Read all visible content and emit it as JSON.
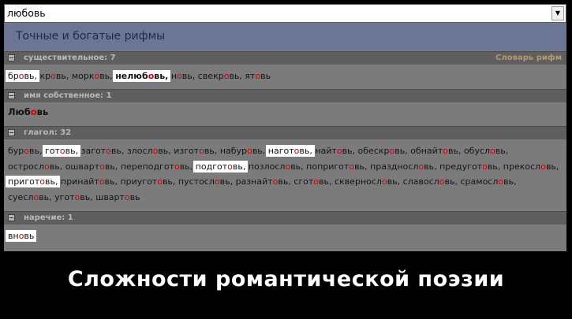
{
  "search": {
    "value": "любовь",
    "dropdown_glyph": "▼"
  },
  "header": {
    "title": "Точные и богатые рифмы"
  },
  "sections": [
    {
      "label": "существительное: 7",
      "link": "Словарь рифм",
      "words": [
        {
          "pre": "бр",
          "hl": "о",
          "post": "вь,",
          "box": true,
          "bold": false
        },
        {
          "pre": "кр",
          "hl": "о",
          "post": "вь,",
          "box": false,
          "bold": false
        },
        {
          "pre": "морк",
          "hl": "о",
          "post": "вь,",
          "box": false,
          "bold": false
        },
        {
          "pre": "нелюб",
          "hl": "о",
          "post": "вь,",
          "box": true,
          "bold": true
        },
        {
          "pre": "н",
          "hl": "о",
          "post": "вь,",
          "box": false,
          "bold": false
        },
        {
          "pre": "свекр",
          "hl": "о",
          "post": "вь,",
          "box": false,
          "bold": false
        },
        {
          "pre": "ят",
          "hl": "о",
          "post": "вь",
          "box": false,
          "bold": false
        }
      ]
    },
    {
      "label": "имя собственное: 1",
      "words": [
        {
          "pre": "Люб",
          "hl": "о",
          "post": "вь",
          "box": false,
          "bold": true
        }
      ]
    },
    {
      "label": "глагол: 32",
      "words": [
        {
          "pre": "бур",
          "hl": "о",
          "post": "вь,",
          "box": false,
          "bold": false
        },
        {
          "pre": "гот",
          "hl": "о",
          "post": "вь,",
          "box": true,
          "bold": false
        },
        {
          "pre": "загот",
          "hl": "о",
          "post": "вь,",
          "box": false,
          "bold": false
        },
        {
          "pre": "злосл",
          "hl": "о",
          "post": "вь,",
          "box": false,
          "bold": false
        },
        {
          "pre": "изгот",
          "hl": "о",
          "post": "вь,",
          "box": false,
          "bold": false
        },
        {
          "pre": "набур",
          "hl": "о",
          "post": "вь,",
          "box": false,
          "bold": false
        },
        {
          "pre": "нагот",
          "hl": "о",
          "post": "вь,",
          "box": true,
          "bold": false
        },
        {
          "pre": "найт",
          "hl": "о",
          "post": "вь,",
          "box": false,
          "bold": false
        },
        {
          "pre": "обескр",
          "hl": "о",
          "post": "вь,",
          "box": false,
          "bold": false
        },
        {
          "pre": "обнайт",
          "hl": "о",
          "post": "вь,",
          "box": false,
          "bold": false
        },
        {
          "pre": "обусл",
          "hl": "о",
          "post": "вь,",
          "box": false,
          "bold": false
        },
        {
          "pre": "остросл",
          "hl": "о",
          "post": "вь,",
          "box": false,
          "bold": false
        },
        {
          "pre": "ошварт",
          "hl": "о",
          "post": "вь,",
          "box": false,
          "bold": false
        },
        {
          "pre": "переподгот",
          "hl": "о",
          "post": "вь,",
          "box": false,
          "bold": false
        },
        {
          "pre": "подгот",
          "hl": "о",
          "post": "вь,",
          "box": true,
          "bold": false
        },
        {
          "pre": "позлосл",
          "hl": "о",
          "post": "вь,",
          "box": false,
          "bold": false
        },
        {
          "pre": "попригот",
          "hl": "о",
          "post": "вь,",
          "box": false,
          "bold": false
        },
        {
          "pre": "праздносл",
          "hl": "о",
          "post": "вь,",
          "box": false,
          "bold": false
        },
        {
          "pre": "предугот",
          "hl": "о",
          "post": "вь,",
          "box": false,
          "bold": false
        },
        {
          "pre": "прекосл",
          "hl": "о",
          "post": "вь,",
          "box": false,
          "bold": false
        },
        {
          "pre": "пригот",
          "hl": "о",
          "post": "вь,",
          "box": true,
          "bold": false
        },
        {
          "pre": "принайт",
          "hl": "о",
          "post": "вь,",
          "box": false,
          "bold": false
        },
        {
          "pre": "приугот",
          "hl": "о",
          "post": "вь,",
          "box": false,
          "bold": false
        },
        {
          "pre": "пустосл",
          "hl": "о",
          "post": "вь,",
          "box": false,
          "bold": false
        },
        {
          "pre": "разнайт",
          "hl": "о",
          "post": "вь,",
          "box": false,
          "bold": false
        },
        {
          "pre": "сгот",
          "hl": "о",
          "post": "вь,",
          "box": false,
          "bold": false
        },
        {
          "pre": "скверносл",
          "hl": "о",
          "post": "вь,",
          "box": false,
          "bold": false
        },
        {
          "pre": "славосл",
          "hl": "о",
          "post": "вь,",
          "box": false,
          "bold": false
        },
        {
          "pre": "срамосл",
          "hl": "о",
          "post": "вь,",
          "box": false,
          "bold": false
        },
        {
          "pre": "суесл",
          "hl": "о",
          "post": "вь,",
          "box": false,
          "bold": false
        },
        {
          "pre": "угот",
          "hl": "о",
          "post": "вь,",
          "box": false,
          "bold": false
        },
        {
          "pre": "шварт",
          "hl": "о",
          "post": "вь",
          "box": false,
          "bold": false
        }
      ]
    },
    {
      "label": "наречие: 1",
      "words": [
        {
          "pre": "вн",
          "hl": "о",
          "post": "вь",
          "box": true,
          "bold": false
        }
      ]
    }
  ],
  "caption": "Сложности романтической поэзии",
  "colors": {
    "stress": "#d30000",
    "panel": "#7b7b7b",
    "header_band": "#6b7596",
    "section_header": "#5f5f5f"
  }
}
